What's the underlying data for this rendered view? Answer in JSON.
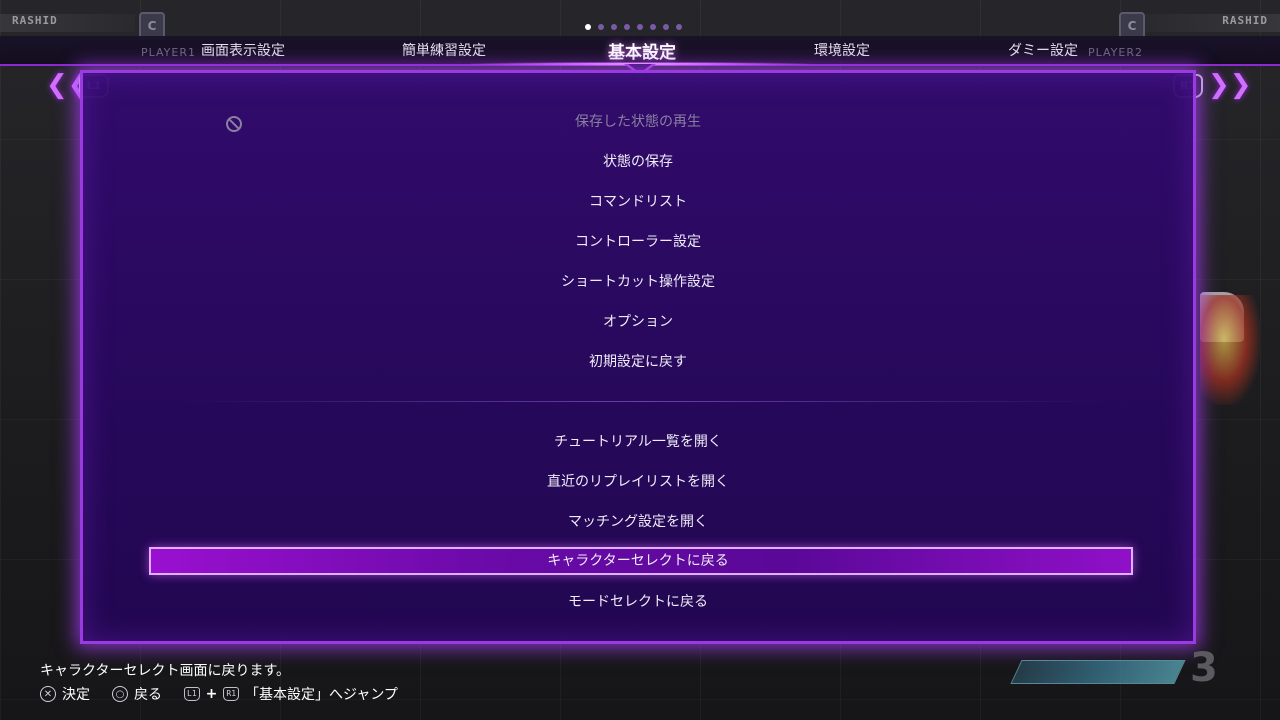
{
  "hud": {
    "player1_name": "RASHID",
    "player2_name": "RASHID",
    "badge_left": "C",
    "badge_right": "C",
    "player1_label": "PLAYER1",
    "player2_label": "PLAYER2",
    "round_number": "3"
  },
  "tabs": {
    "left_button": "L1",
    "right_button": "R1",
    "items": [
      {
        "label": "画面表示設定"
      },
      {
        "label": "簡単練習設定"
      },
      {
        "label": "基本設定",
        "active": true
      },
      {
        "label": "環境設定"
      },
      {
        "label": "ダミー設定"
      }
    ],
    "page_count": 8,
    "active_page": 1
  },
  "menu": {
    "group1": [
      {
        "label": "保存した状態の再生",
        "disabled": true
      },
      {
        "label": "状態の保存"
      },
      {
        "label": "コマンドリスト"
      },
      {
        "label": "コントローラー設定"
      },
      {
        "label": "ショートカット操作設定"
      },
      {
        "label": "オプション"
      },
      {
        "label": "初期設定に戻す"
      }
    ],
    "group2": [
      {
        "label": "チュートリアル一覧を開く"
      },
      {
        "label": "直近のリプレイリストを開く"
      },
      {
        "label": "マッチング設定を開く"
      },
      {
        "label": "キャラクターセレクトに戻る",
        "selected": true
      },
      {
        "label": "モードセレクトに戻る"
      }
    ]
  },
  "footer": {
    "description": "キャラクターセレクト画面に戻ります。",
    "confirm_label": "決定",
    "back_label": "戻る",
    "jump_l1": "L1",
    "jump_plus": "+",
    "jump_r1": "R1",
    "jump_label": "「基本設定」へジャンプ"
  },
  "colors": {
    "accent": "#9a3ae0",
    "panel_bg": "#32086e",
    "selected": "#9a10d0"
  }
}
